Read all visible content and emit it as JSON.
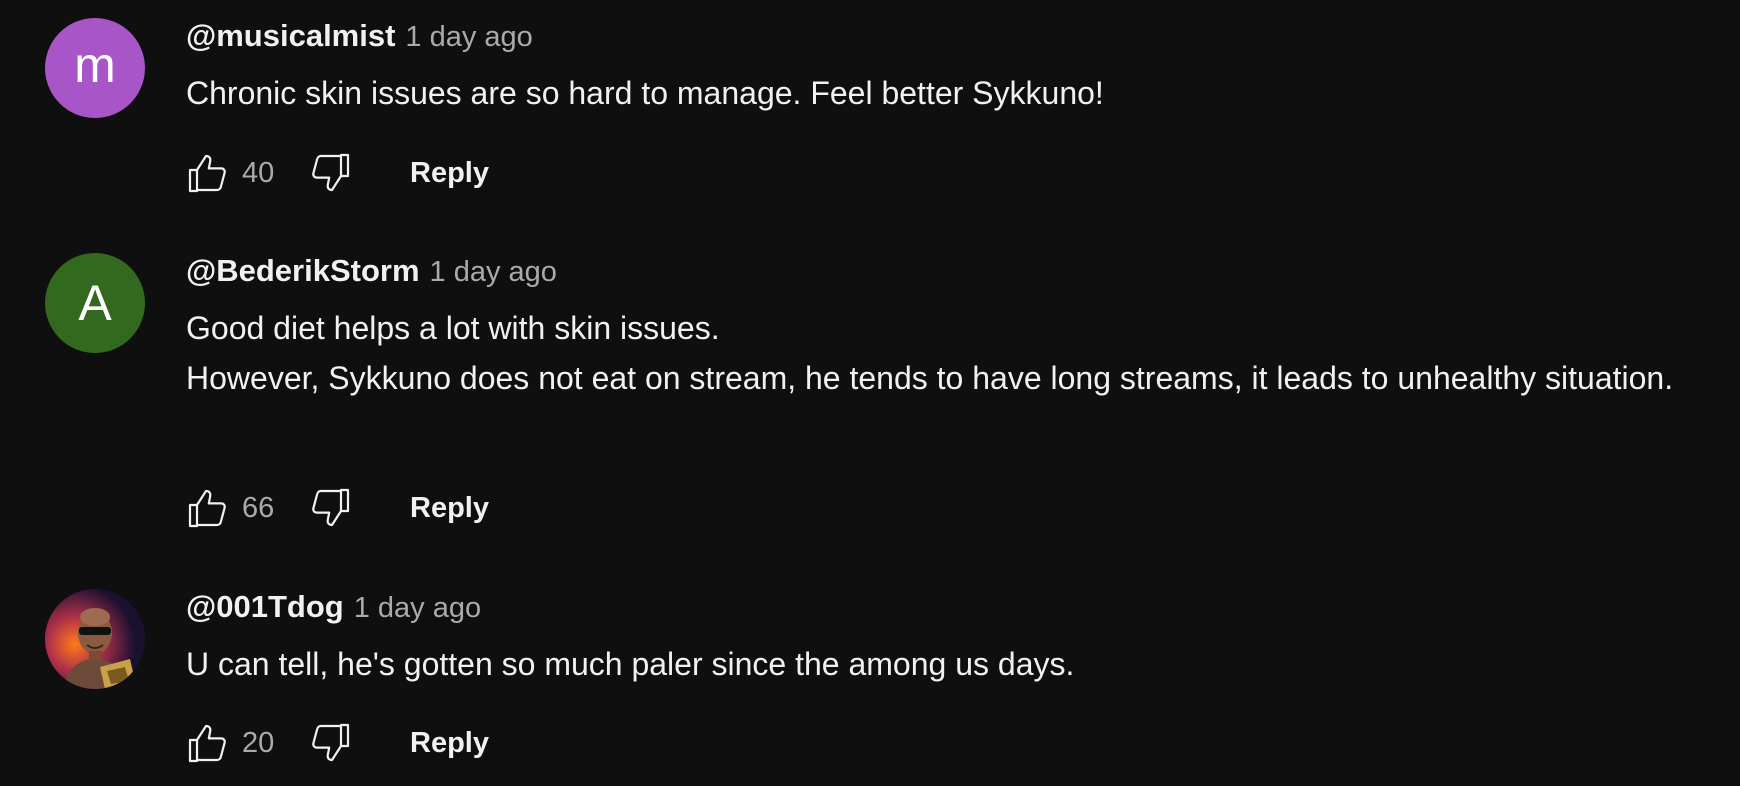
{
  "comments": [
    {
      "author": "@musicalmist",
      "time": "1 day ago",
      "avatar_letter": "m",
      "avatar_color": "#a855c8",
      "text": "Chronic skin issues are so hard to manage. Feel better Sykkuno!",
      "likes": "40",
      "reply_label": "Reply"
    },
    {
      "author": "@BederikStorm",
      "time": "1 day ago",
      "avatar_letter": "A",
      "avatar_color": "#33691e",
      "text": "Good diet helps a lot with skin issues.\nHowever, Sykkuno does not eat on stream, he tends to have long streams, it leads to unhealthy situation.",
      "likes": "66",
      "reply_label": "Reply"
    },
    {
      "author": "@001Tdog",
      "time": "1 day ago",
      "avatar_image": "profile-photo",
      "text": "U can tell, he's gotten so much paler since the among us days.",
      "likes": "20",
      "reply_label": "Reply"
    }
  ],
  "icons": {
    "like": "thumbs-up-icon",
    "dislike": "thumbs-down-icon"
  }
}
